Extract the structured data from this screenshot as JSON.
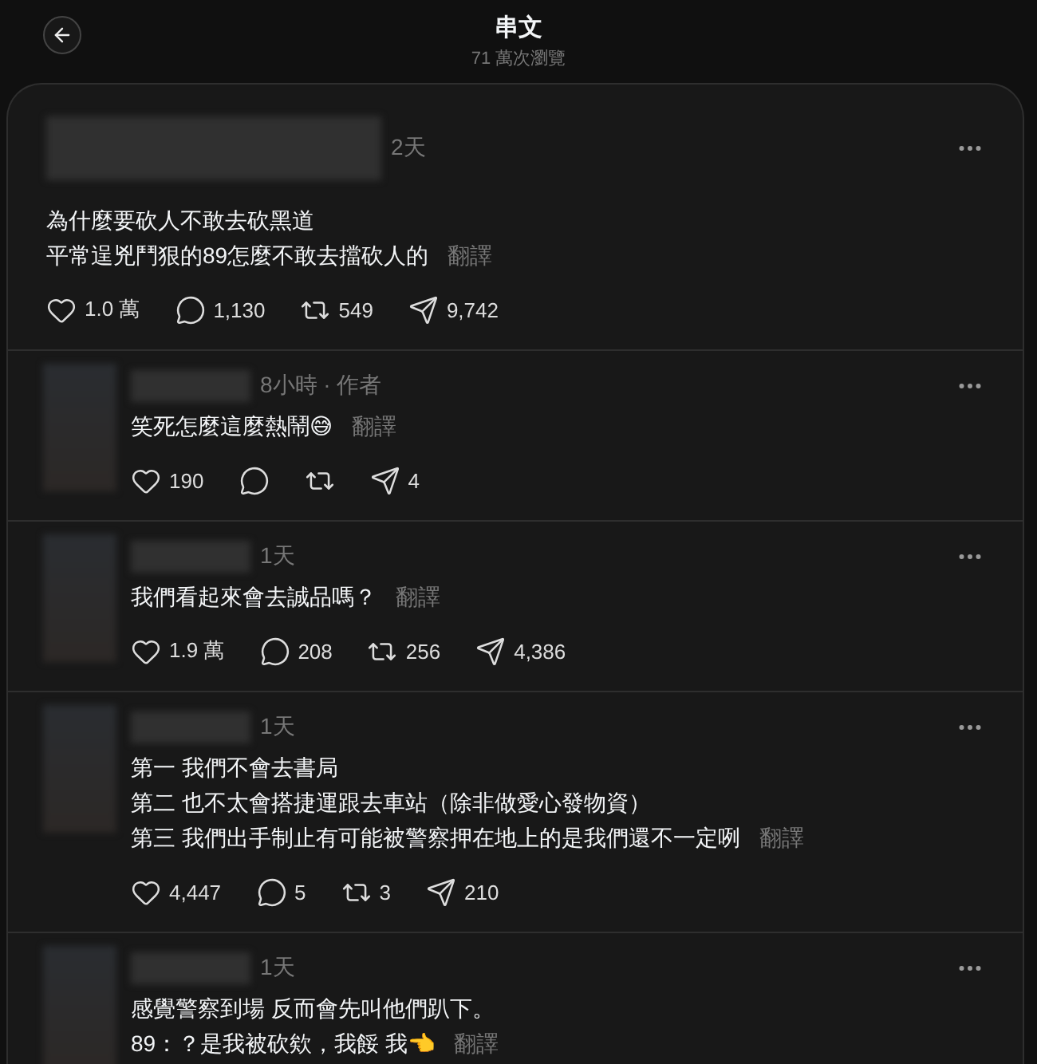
{
  "header": {
    "title": "串文",
    "views": "71 萬次瀏覽"
  },
  "posts": [
    {
      "kind": "main",
      "time": "2天",
      "lines": [
        "為什麼要砍人不敢去砍黑道",
        "平常逞兇鬥狠的89怎麼不敢去擋砍人的"
      ],
      "translate": "翻譯",
      "stats": {
        "likes": "1.0 萬",
        "replies": "1,130",
        "reposts": "549",
        "shares": "9,742"
      }
    },
    {
      "kind": "reply",
      "time": "8小時 · 作者",
      "lines": [
        "笑死怎麼這麼熱鬧😅"
      ],
      "translate": "翻譯",
      "stats": {
        "likes": "190",
        "shares": "4"
      }
    },
    {
      "kind": "reply",
      "time": "1天",
      "lines": [
        "我們看起來會去誠品嗎？"
      ],
      "translate": "翻譯",
      "stats": {
        "likes": "1.9 萬",
        "replies": "208",
        "reposts": "256",
        "shares": "4,386"
      }
    },
    {
      "kind": "reply",
      "time": "1天",
      "lines": [
        "第一 我們不會去書局",
        "第二 也不太會搭捷運跟去車站（除非做愛心發物資）",
        "第三 我們出手制止有可能被警察押在地上的是我們還不一定咧"
      ],
      "translate": "翻譯",
      "stats": {
        "likes": "4,447",
        "replies": "5",
        "reposts": "3",
        "shares": "210"
      }
    },
    {
      "kind": "reply",
      "time": "1天",
      "lines": [
        "感覺警察到場 反而會先叫他們趴下。",
        "89：？是我被砍欸，我餒 我👈"
      ],
      "translate": "翻譯"
    }
  ]
}
